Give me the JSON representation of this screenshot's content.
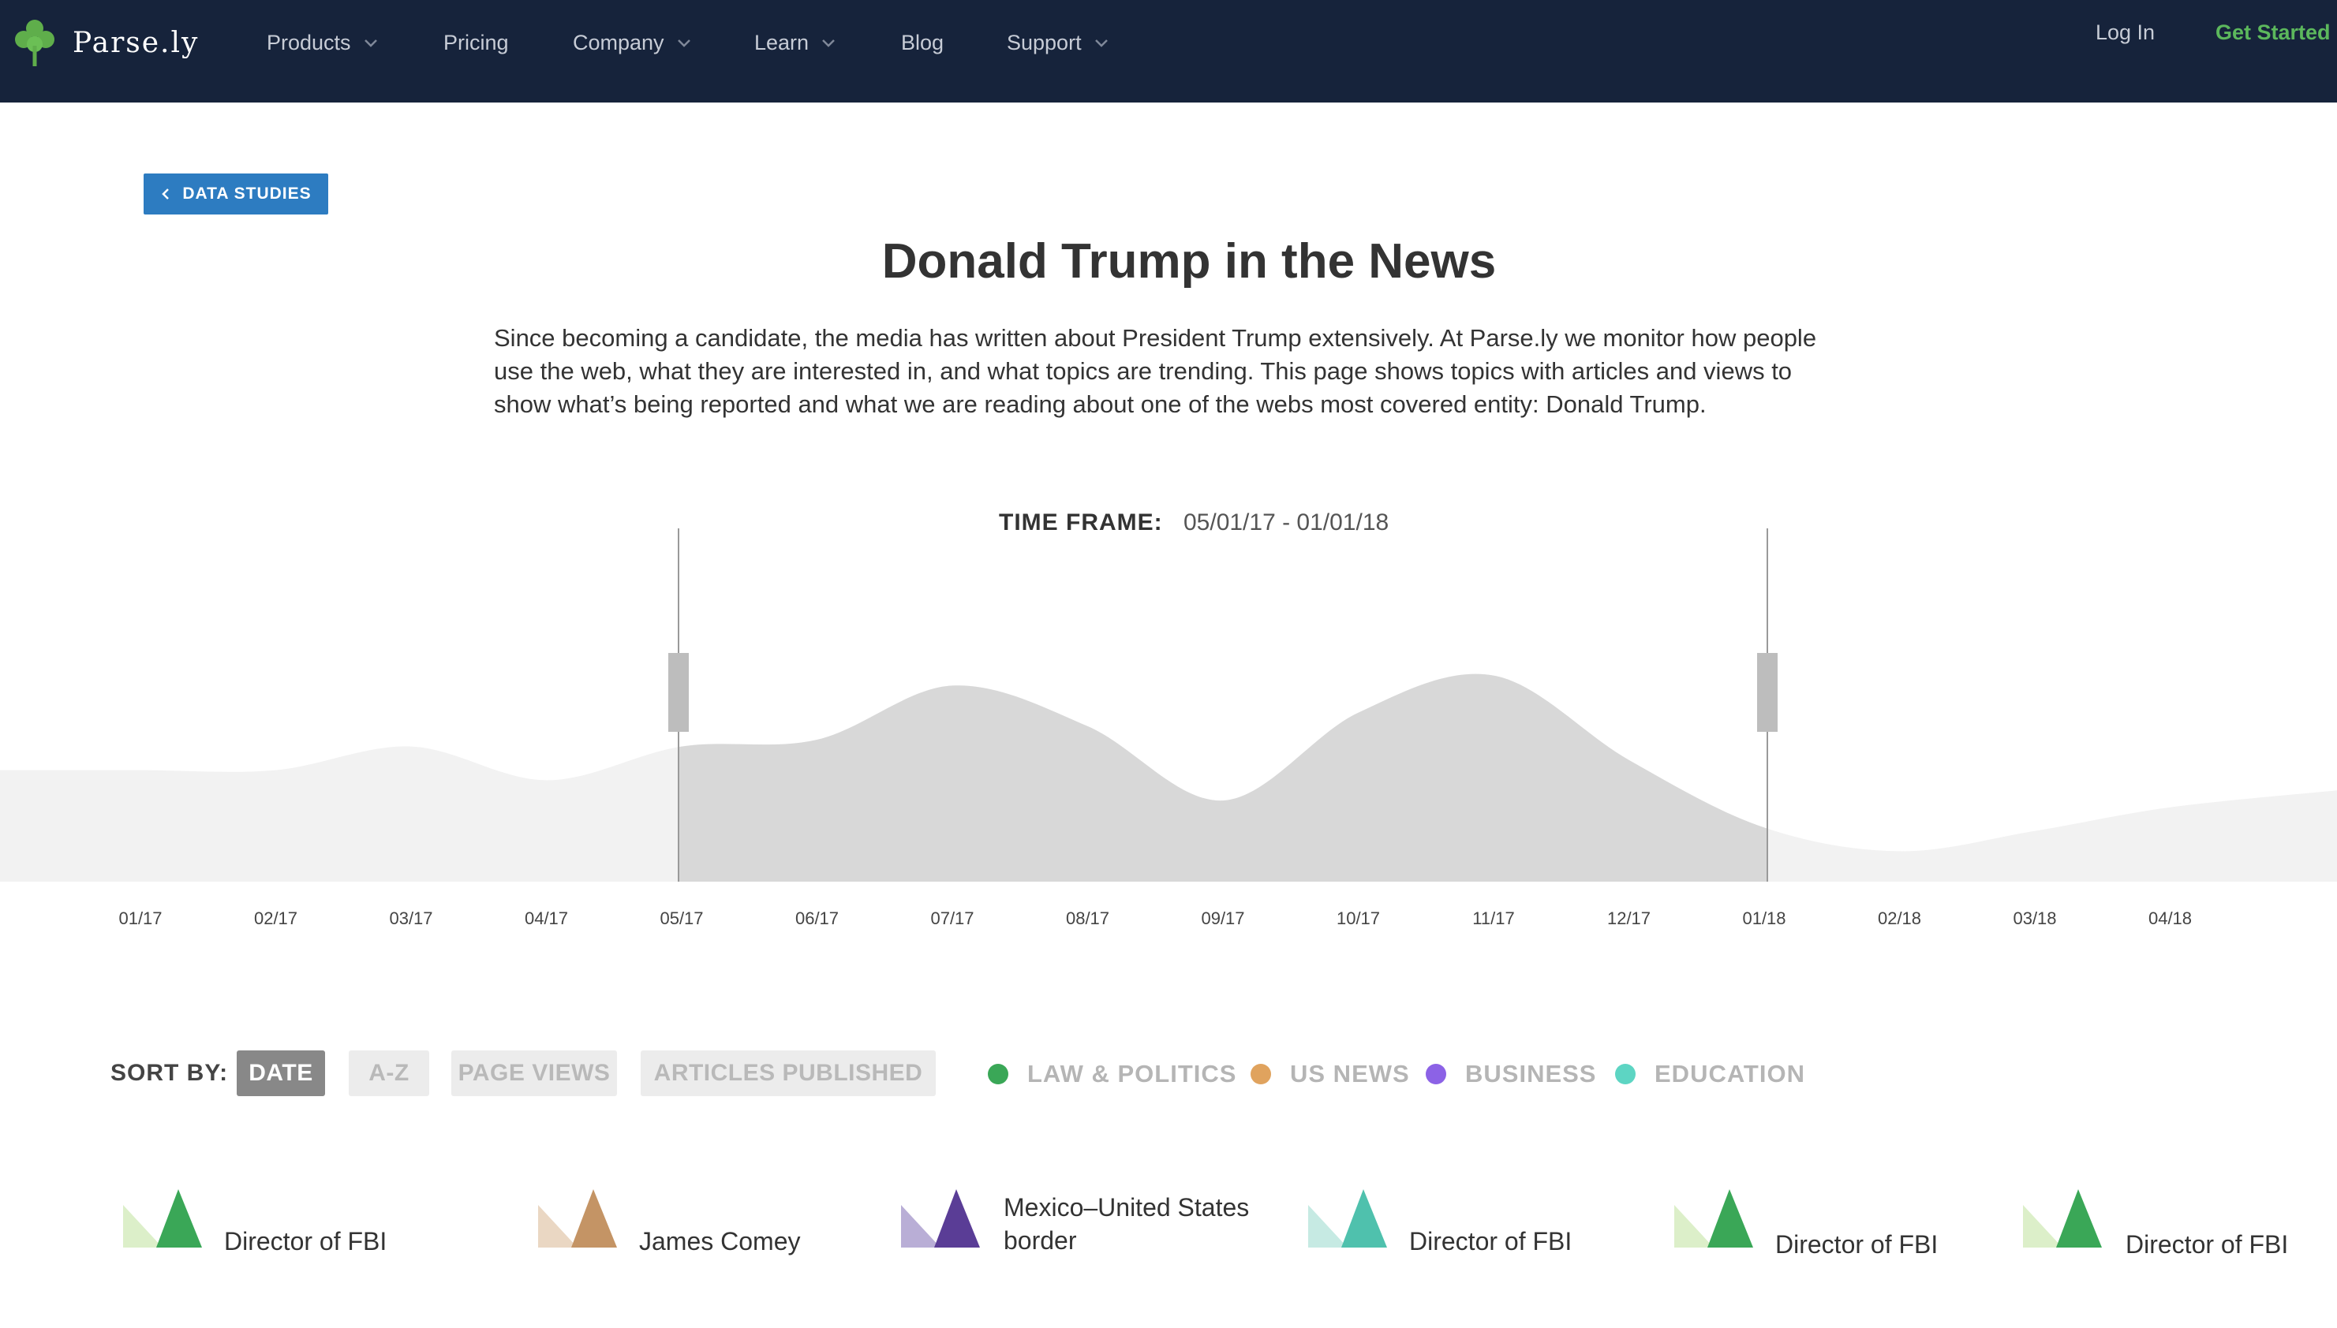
{
  "nav": {
    "brand": "Parse.ly",
    "items": [
      {
        "label": "Products",
        "dropdown": true
      },
      {
        "label": "Pricing",
        "dropdown": false
      },
      {
        "label": "Company",
        "dropdown": true
      },
      {
        "label": "Learn",
        "dropdown": true
      },
      {
        "label": "Blog",
        "dropdown": false
      },
      {
        "label": "Support",
        "dropdown": true
      }
    ],
    "login": "Log In",
    "get_started": "Get Started"
  },
  "back_button": "DATA STUDIES",
  "title": "Donald Trump in the News",
  "intro": "Since becoming a candidate, the media has written about President Trump extensively. At Parse.ly we monitor how people use the web, what they are interested in, and what topics are trending. This page shows topics with articles and views to show what’s being reported and what we are reading about one of the webs most covered entity: Donald Trump.",
  "timeframe": {
    "label": "TIME FRAME:",
    "value": "05/01/17 - 01/01/18"
  },
  "chart_data": {
    "type": "area",
    "x": [
      "01/17",
      "02/17",
      "03/17",
      "04/17",
      "05/17",
      "06/17",
      "07/17",
      "08/17",
      "09/17",
      "10/17",
      "11/17",
      "12/17",
      "01/18",
      "02/18",
      "03/18",
      "04/18"
    ],
    "values": [
      33,
      33,
      40,
      30,
      40,
      42,
      58,
      46,
      24,
      50,
      61,
      36,
      16,
      9,
      15,
      22
    ],
    "selection": {
      "start": "05/17",
      "end": "01/18"
    },
    "ylim": [
      0,
      70
    ],
    "colors": {
      "selected": "#d8d8d8",
      "unselected": "#f2f2f2",
      "handle": "#bdbdbd"
    }
  },
  "sort": {
    "label": "SORT BY:",
    "options": [
      {
        "label": "DATE",
        "active": true
      },
      {
        "label": "A-Z",
        "active": false
      },
      {
        "label": "PAGE VIEWS",
        "active": false
      },
      {
        "label": "ARTICLES PUBLISHED",
        "active": false
      }
    ]
  },
  "legend": [
    {
      "label": "LAW & POLITICS",
      "color": "#3aa757"
    },
    {
      "label": "US NEWS",
      "color": "#e0a35e"
    },
    {
      "label": "BUSINESS",
      "color": "#8c62e6"
    },
    {
      "label": "EDUCATION",
      "color": "#5dd5c3"
    }
  ],
  "cards": [
    {
      "label": "Director of FBI",
      "icon": "triangles-green-icon",
      "light": "#dcefc9",
      "dark": "#3aa757"
    },
    {
      "label": "James Comey",
      "icon": "triangles-tan-icon",
      "light": "#ead7c3",
      "dark": "#c49465"
    },
    {
      "label": "Mexico–United States border",
      "line1": "Mexico–United States",
      "line2": "border",
      "icon": "triangles-purple-icon",
      "light": "#b9aed6",
      "dark": "#5a3d96"
    },
    {
      "label": "Director of FBI",
      "icon": "triangles-teal-icon",
      "light": "#c6eae3",
      "dark": "#4fc1ad"
    },
    {
      "label": "Director of FBI",
      "icon": "triangles-green-icon",
      "light": "#dcefc9",
      "dark": "#3aa757"
    },
    {
      "label": "Director of FBI",
      "icon": "triangles-green-icon",
      "light": "#dcefc9",
      "dark": "#3aa757"
    }
  ]
}
